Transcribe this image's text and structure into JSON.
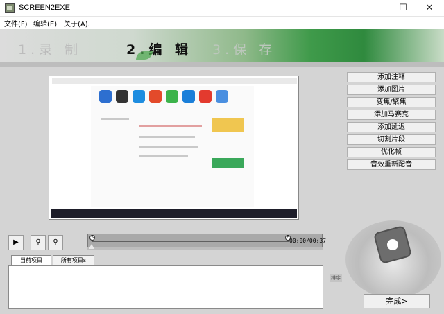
{
  "window": {
    "title": "SCREEN2EXE",
    "minimize_glyph": "—",
    "maximize_glyph": "☐",
    "close_glyph": "✕"
  },
  "menu": {
    "items": [
      "文件(F)",
      "编辑(E)",
      "关于(A)."
    ]
  },
  "steps": {
    "record": "1.录 制",
    "edit": "2.编 辑",
    "save": "3.保 存",
    "active": "edit"
  },
  "side_buttons": [
    "添加注释",
    "添加图片",
    "变焦/聚焦",
    "添加马赛克",
    "添加延迟",
    "切割片段",
    "优化帧",
    "音效重新配音"
  ],
  "controls": {
    "play_glyph": "▶",
    "marker_in_glyph": "⚲",
    "marker_out_glyph": "⚲"
  },
  "timeline": {
    "time": "00:00/00:37",
    "start_marker": "S",
    "end_marker": "E",
    "progress": 0
  },
  "tabs": [
    "当前项目",
    "所有项目s"
  ],
  "sort_label": "排序",
  "finish_button": "完成>",
  "icons": {
    "app": "screen2exe-app-icon",
    "play": "play-icon",
    "marker_in": "marker-in-icon",
    "marker_out": "marker-out-icon"
  }
}
